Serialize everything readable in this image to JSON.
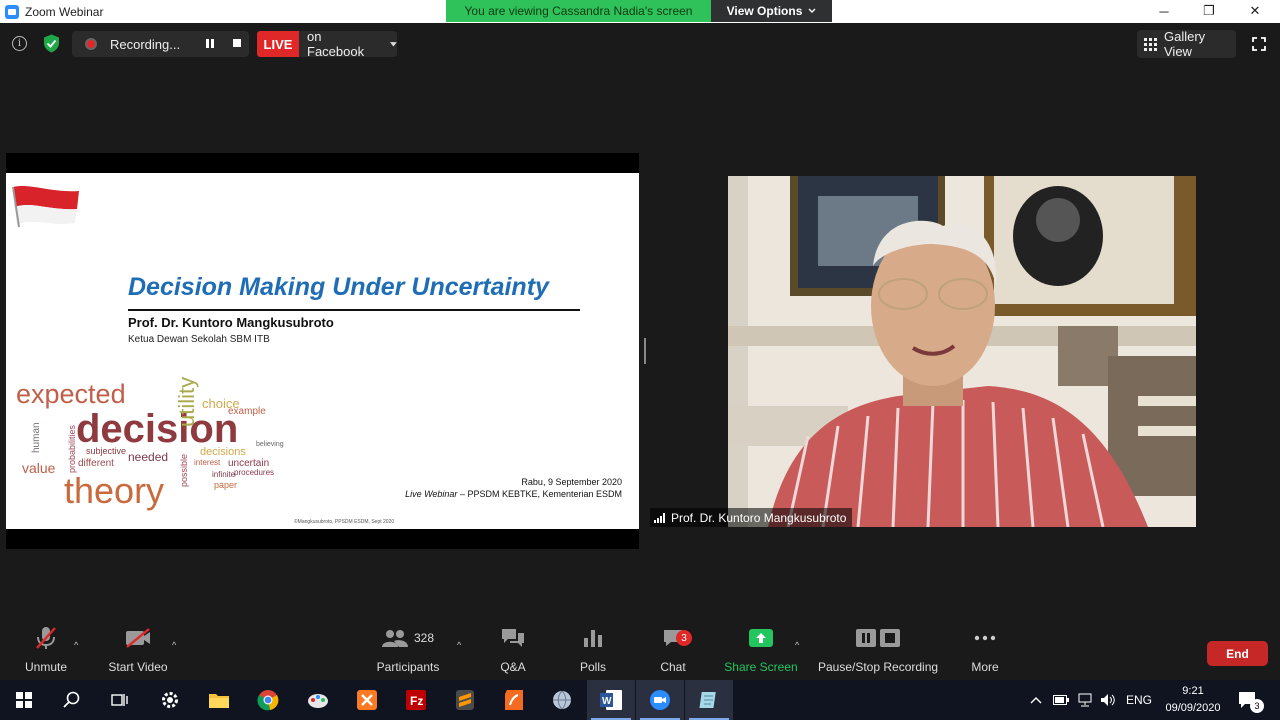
{
  "window": {
    "title": "Zoom Webinar",
    "viewing_banner": "You are viewing Cassandra Nadia's screen",
    "view_options_label": "View Options",
    "minimize": "─",
    "maximize": "❐",
    "close": "✕"
  },
  "topbar": {
    "info_glyph": "i",
    "recording_label": "Recording...",
    "live_label": "LIVE",
    "live_target": "on Facebook",
    "gallery_label": "Gallery View"
  },
  "slide": {
    "title": "Decision Making Under Uncertainty",
    "author": "Prof. Dr. Kuntoro Mangkusubroto",
    "affiliation": "Ketua Dewan Sekolah SBM ITB",
    "date": "Rabu, 9 September 2020",
    "event_prefix": "Live Webinar",
    "event_rest": " – PPSDM KEBTKE, Kementerian ESDM",
    "copyright": "©Mangkusubroto, PPSDM ESDM, Sept 2020",
    "wordcloud": {
      "expected": "expected",
      "decision": "decision",
      "theory": "theory",
      "utility": "utility",
      "value": "value",
      "choice": "choice",
      "decisions": "decisions",
      "needed": "needed",
      "different": "different",
      "human": "human",
      "uncertain": "uncertain",
      "example": "example",
      "subjective": "subjective",
      "probabilities": "probabilities",
      "infinite": "infinite",
      "paper": "paper",
      "believing": "believing",
      "interest": "interest",
      "possible": "possible",
      "procedures": "procedures"
    }
  },
  "video": {
    "participant_name": "Prof. Dr. Kuntoro Mangkusubroto"
  },
  "toolbar": {
    "unmute": "Unmute",
    "start_video": "Start Video",
    "participants_count": "328",
    "participants": "Participants",
    "qa": "Q&A",
    "polls": "Polls",
    "chat": "Chat",
    "chat_badge": "3",
    "share_screen": "Share Screen",
    "pause_stop_recording": "Pause/Stop Recording",
    "more": "More",
    "end": "End"
  },
  "taskbar": {
    "language": "ENG",
    "time": "9:21",
    "date": "09/09/2020",
    "notification_count": "3"
  },
  "colors": {
    "zoom_blue": "#2d8cff",
    "live_red": "#e02828",
    "share_green": "#23c55e",
    "slide_title_blue": "#1f6db5"
  }
}
